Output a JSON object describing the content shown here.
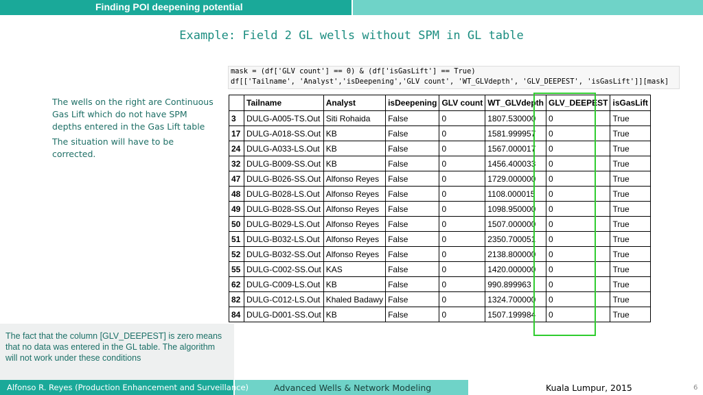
{
  "header": {
    "title": "Finding POI deepening potential"
  },
  "slide": {
    "title": "Example: Field 2 GL wells without SPM in GL table"
  },
  "side_text": [
    "The wells on the right are Continuous Gas Lift which do not have SPM depths entered in the Gas Lift table",
    "The situation will have to be corrected."
  ],
  "note": "The fact that the column [GLV_DEEPEST] is zero means that no data was entered in the GL table. The algorithm will not work under these conditions",
  "code": {
    "line1": "mask = (df['GLV count'] == 0) & (df['isGasLift'] == True)",
    "line2": "df[['Tailname', 'Analyst','isDeepening','GLV count', 'WT_GLVdepth', 'GLV_DEEPEST', 'isGasLift']][mask]"
  },
  "table": {
    "columns": [
      "",
      "Tailname",
      "Analyst",
      "isDeepening",
      "GLV count",
      "WT_GLVdepth",
      "GLV_DEEPEST",
      "isGasLift"
    ],
    "rows": [
      [
        "3",
        "DULG-A005-TS.Out",
        "Siti Rohaida",
        "False",
        "0",
        "1807.530000",
        "0",
        "True"
      ],
      [
        "17",
        "DULG-A018-SS.Out",
        "KB",
        "False",
        "0",
        "1581.999957",
        "0",
        "True"
      ],
      [
        "24",
        "DULG-A033-LS.Out",
        "KB",
        "False",
        "0",
        "1567.000017",
        "0",
        "True"
      ],
      [
        "32",
        "DULG-B009-SS.Out",
        "KB",
        "False",
        "0",
        "1456.400033",
        "0",
        "True"
      ],
      [
        "47",
        "DULG-B026-SS.Out",
        "Alfonso Reyes",
        "False",
        "0",
        "1729.000000",
        "0",
        "True"
      ],
      [
        "48",
        "DULG-B028-LS.Out",
        "Alfonso Reyes",
        "False",
        "0",
        "1108.000015",
        "0",
        "True"
      ],
      [
        "49",
        "DULG-B028-SS.Out",
        "Alfonso Reyes",
        "False",
        "0",
        "1098.950000",
        "0",
        "True"
      ],
      [
        "50",
        "DULG-B029-LS.Out",
        "Alfonso Reyes",
        "False",
        "0",
        "1507.000000",
        "0",
        "True"
      ],
      [
        "51",
        "DULG-B032-LS.Out",
        "Alfonso Reyes",
        "False",
        "0",
        "2350.700051",
        "0",
        "True"
      ],
      [
        "52",
        "DULG-B032-SS.Out",
        "Alfonso Reyes",
        "False",
        "0",
        "2138.800000",
        "0",
        "True"
      ],
      [
        "55",
        "DULG-C002-SS.Out",
        "KAS",
        "False",
        "0",
        "1420.000000",
        "0",
        "True"
      ],
      [
        "62",
        "DULG-C009-LS.Out",
        "KB",
        "False",
        "0",
        "990.899963",
        "0",
        "True"
      ],
      [
        "82",
        "DULG-C012-LS.Out",
        "Khaled Badawy",
        "False",
        "0",
        "1324.700000",
        "0",
        "True"
      ],
      [
        "84",
        "DULG-D001-SS.Out",
        "KB",
        "False",
        "0",
        "1507.199984",
        "0",
        "True"
      ]
    ]
  },
  "footer": {
    "author": "Alfonso R. Reyes (Production Enhancement and Surveillance)",
    "course": "Advanced Wells & Network Modeling",
    "location": "Kuala Lumpur, 2015",
    "page": "6"
  },
  "colors": {
    "teal": "#1aa999",
    "light_teal": "#6fd3c8",
    "highlight": "#2ecc2e"
  }
}
